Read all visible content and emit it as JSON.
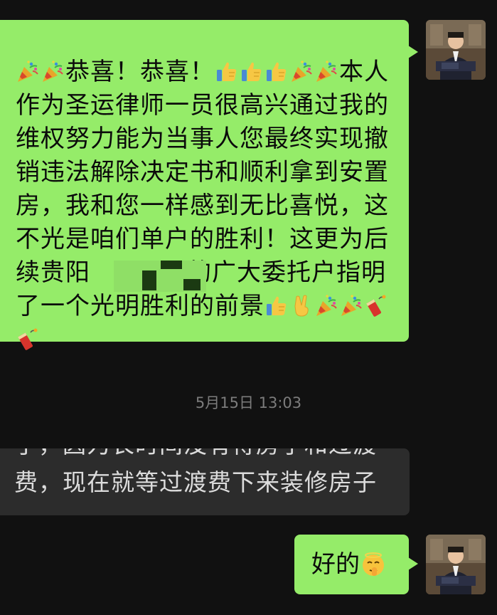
{
  "chat": {
    "messages": [
      {
        "sender": "self",
        "segments": [
          {
            "type": "emoji",
            "icon": "party-popper-icon"
          },
          {
            "type": "emoji",
            "icon": "party-popper-icon"
          },
          {
            "type": "text",
            "text": "恭喜！恭喜！"
          },
          {
            "type": "emoji",
            "icon": "thumbs-up-icon"
          },
          {
            "type": "emoji",
            "icon": "thumbs-up-icon"
          },
          {
            "type": "emoji",
            "icon": "thumbs-up-icon"
          },
          {
            "type": "emoji",
            "icon": "party-popper-icon"
          },
          {
            "type": "emoji",
            "icon": "party-popper-icon"
          },
          {
            "type": "text",
            "text": "本人作为圣运律师一员很高兴通过我的维权努力能为当事人您最终实现撤销违法解除决定书和顺利拿到安置房，我和您一样感到无比喜悦，这不光是咱们单户的胜利！这更为后续贵阳"
          },
          {
            "type": "redacted"
          },
          {
            "type": "text",
            "text": "的广大委托户指明了一个光明胜利的前景"
          },
          {
            "type": "emoji",
            "icon": "thumbs-up-icon"
          },
          {
            "type": "emoji",
            "icon": "victory-hand-icon"
          },
          {
            "type": "emoji",
            "icon": "party-popper-icon"
          },
          {
            "type": "emoji",
            "icon": "party-popper-icon"
          },
          {
            "type": "emoji",
            "icon": "firecracker-icon"
          },
          {
            "type": "emoji",
            "icon": "firecracker-icon"
          }
        ]
      },
      {
        "sender": "other",
        "cut_text": "了，因为长时间没有得房子和过渡",
        "text": "费，现在就等过渡费下来装修房子"
      },
      {
        "sender": "self",
        "text": "好的",
        "emoji": "shushing-face-icon"
      }
    ],
    "timestamp": "5月15日 13:03"
  },
  "colors": {
    "background": "#111111",
    "outgoing_bubble": "#95ec69",
    "incoming_bubble": "#2c2c2c",
    "timestamp_text": "#7c7c7c"
  }
}
